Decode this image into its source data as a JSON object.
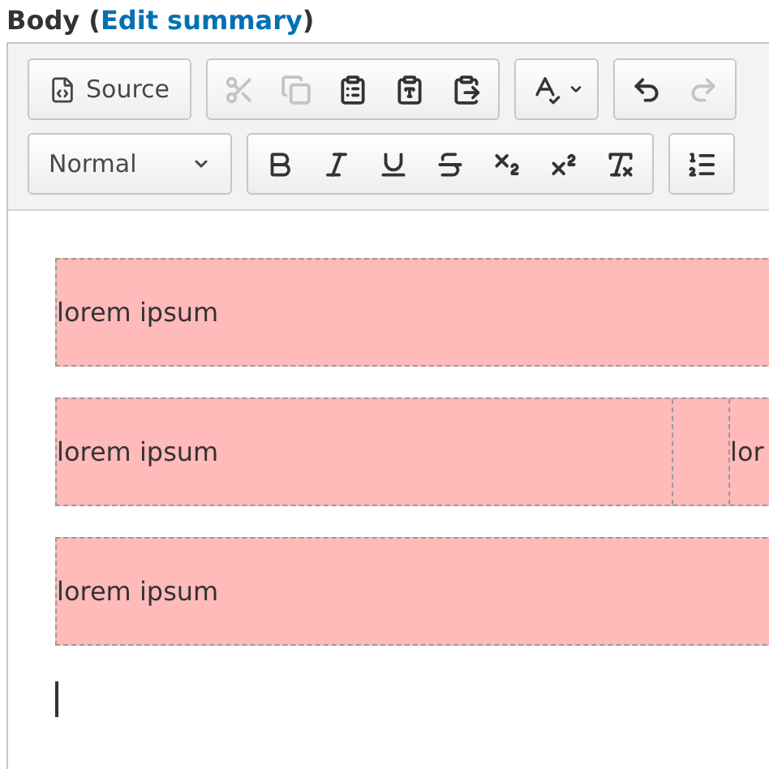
{
  "label": {
    "before": "Body (",
    "link": "Edit summary",
    "after": ")"
  },
  "toolbar": {
    "row_1": [
      {
        "kind": "text",
        "text": "Source",
        "disabled": false
      },
      {
        "kind": "icons",
        "items": [
          {
            "disabled": true
          },
          {
            "disabled": true
          },
          {
            "disabled": false
          },
          {
            "disabled": false
          },
          {
            "disabled": false
          }
        ]
      },
      {
        "kind": "spell",
        "disabled": false
      },
      {
        "kind": "icons",
        "items": [
          {
            "disabled": false
          },
          {
            "disabled": true
          }
        ]
      }
    ],
    "row_2": [
      {
        "kind": "dropdown",
        "text": "Normal"
      },
      {
        "kind": "icons",
        "items": [
          {
            "disabled": false
          },
          {
            "disabled": false
          },
          {
            "disabled": false
          },
          {
            "disabled": false
          },
          {
            "disabled": false
          },
          {
            "disabled": false
          },
          {
            "disabled": false
          }
        ]
      },
      {
        "kind": "icons",
        "items": [
          {
            "disabled": false
          }
        ]
      }
    ]
  },
  "content": [
    {
      "cells": [
        "lorem ipsum"
      ]
    },
    {
      "cells": [
        "lorem ipsum",
        "lor"
      ]
    },
    {
      "cells": [
        "lorem ipsum"
      ]
    }
  ]
}
